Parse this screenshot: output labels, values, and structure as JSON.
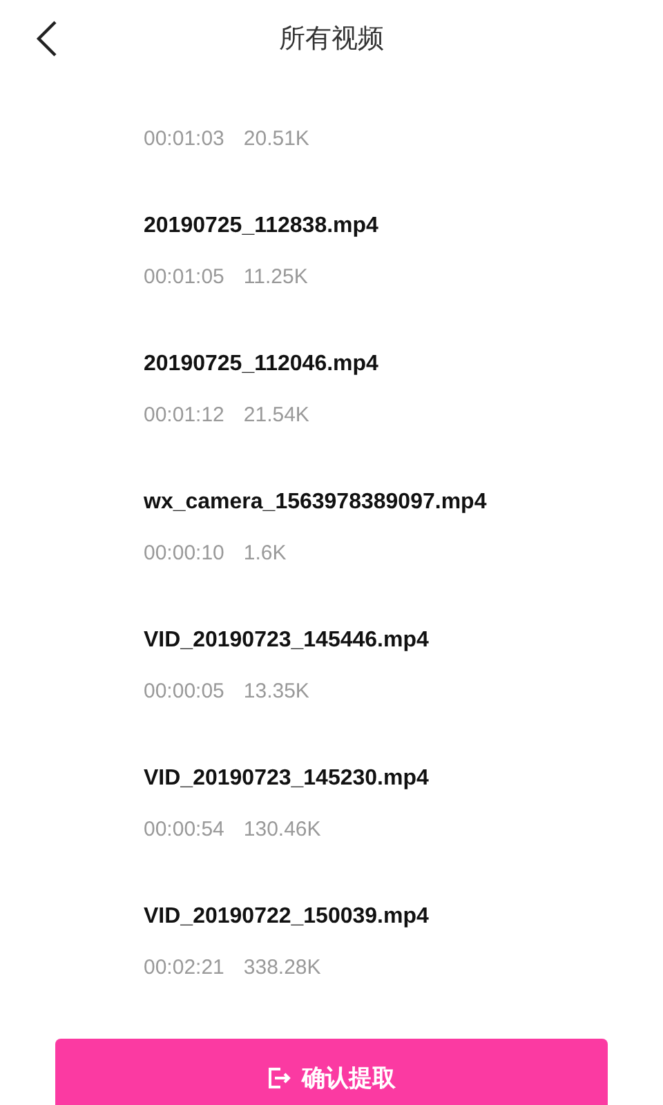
{
  "header": {
    "title": "所有视频"
  },
  "videos": [
    {
      "duration": "00:01:03",
      "size": "20.51K"
    },
    {
      "name": "20190725_112838.mp4",
      "duration": "00:01:05",
      "size": "11.25K"
    },
    {
      "name": "20190725_112046.mp4",
      "duration": "00:01:12",
      "size": "21.54K"
    },
    {
      "name": "wx_camera_1563978389097.mp4",
      "duration": "00:00:10",
      "size": "1.6K"
    },
    {
      "name": "VID_20190723_145446.mp4",
      "duration": "00:00:05",
      "size": "13.35K"
    },
    {
      "name": "VID_20190723_145230.mp4",
      "duration": "00:00:54",
      "size": "130.46K"
    },
    {
      "name": "VID_20190722_150039.mp4",
      "duration": "00:02:21",
      "size": "338.28K"
    }
  ],
  "confirm_button": {
    "label": "确认提取"
  }
}
